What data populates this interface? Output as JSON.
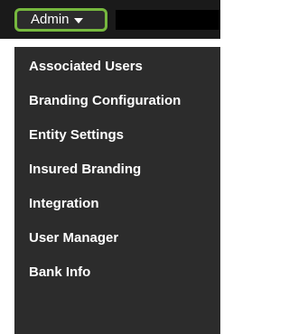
{
  "admin_menu": {
    "label": "Admin",
    "items": [
      {
        "label": "Associated Users"
      },
      {
        "label": "Branding Configuration"
      },
      {
        "label": "Entity Settings"
      },
      {
        "label": "Insured Branding"
      },
      {
        "label": "Integration"
      },
      {
        "label": "User Manager"
      },
      {
        "label": "Bank Info"
      }
    ]
  },
  "colors": {
    "topbar": "#1a1a1a",
    "menu_background": "#2c2c2c",
    "highlight_border": "#76b83e",
    "text": "#ffffff"
  }
}
